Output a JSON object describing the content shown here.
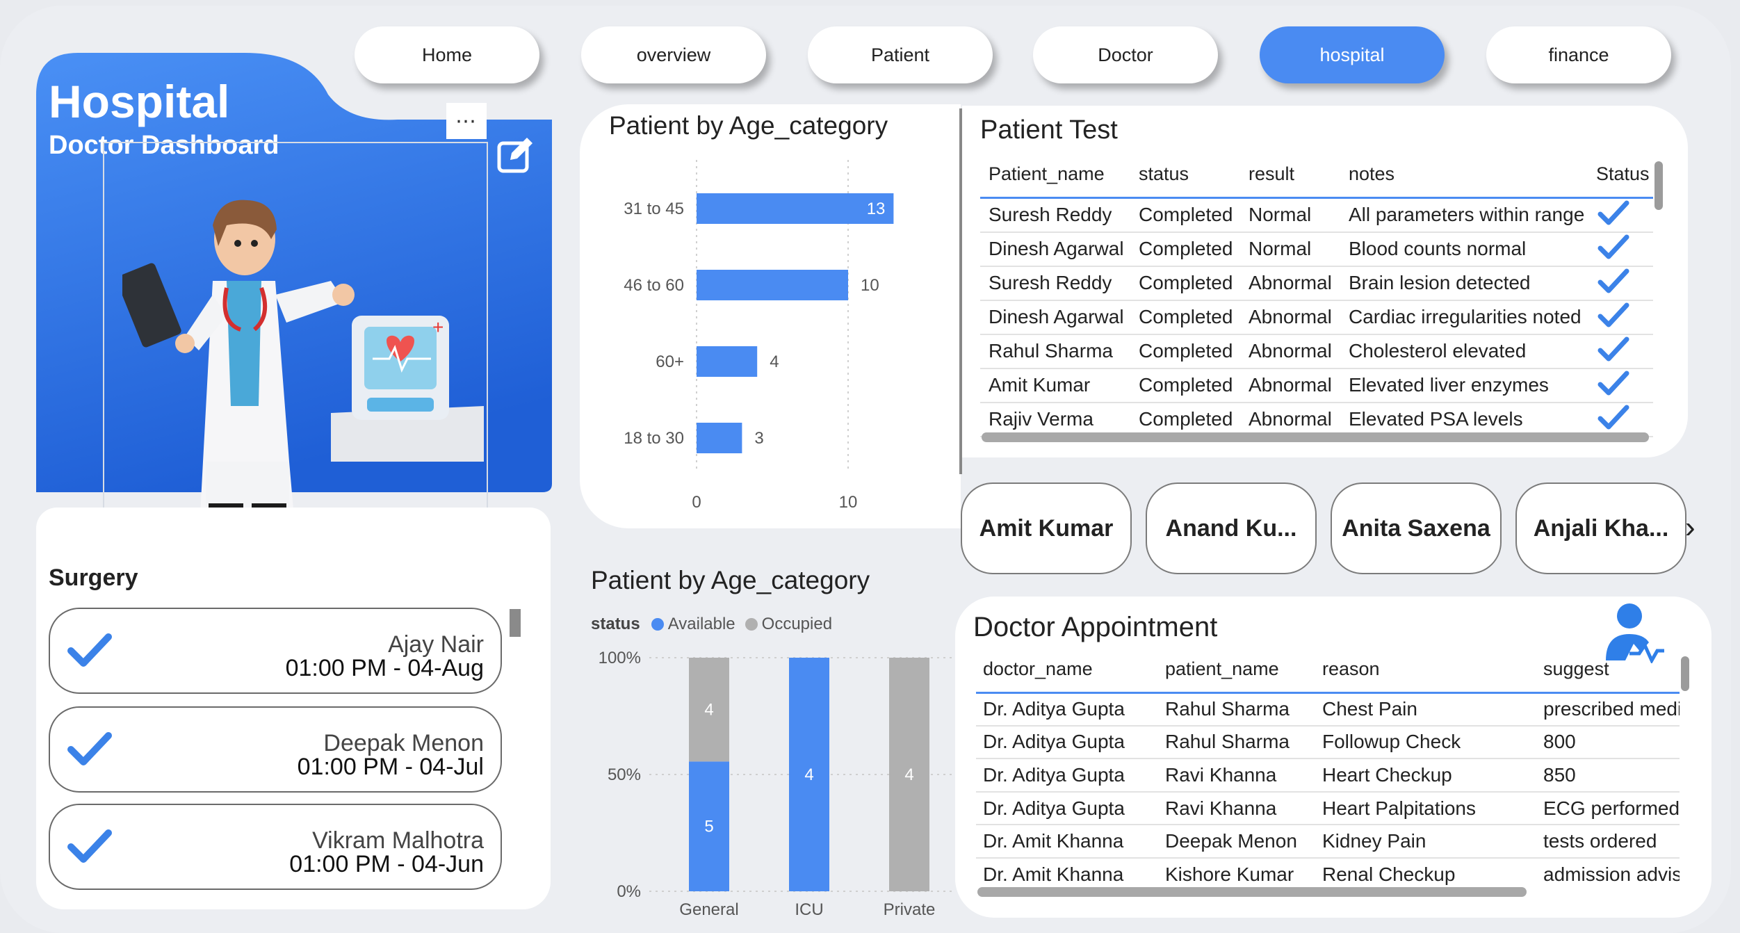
{
  "nav": {
    "items": [
      {
        "label": "Home",
        "active": false
      },
      {
        "label": "overview",
        "active": false
      },
      {
        "label": "Patient",
        "active": false
      },
      {
        "label": "Doctor",
        "active": false
      },
      {
        "label": "hospital",
        "active": true
      },
      {
        "label": "finance",
        "active": false
      }
    ]
  },
  "hero": {
    "title": "Hospital",
    "subtitle": "Doctor Dashboard",
    "menu_icon": "more-horizontal-icon",
    "edit_icon": "edit-icon",
    "illustration": "doctor-illustration"
  },
  "surgery": {
    "title": "Surgery",
    "items": [
      {
        "name": "Ajay Nair",
        "time": "01:00 PM - 04-Aug"
      },
      {
        "name": "Deepak Menon",
        "time": "01:00 PM - 04-Jul"
      },
      {
        "name": "Vikram Malhotra",
        "time": "01:00 PM - 04-Jun"
      }
    ]
  },
  "chart_data": [
    {
      "type": "bar",
      "title": "Patient by Age_category",
      "orientation": "horizontal",
      "categories": [
        "31 to 45",
        "46 to 60",
        "60+",
        "18 to 30"
      ],
      "values": [
        13,
        10,
        4,
        3
      ],
      "xlim": [
        0,
        13
      ],
      "xticks": [
        0,
        10
      ],
      "color": "#4a8bf2"
    },
    {
      "type": "bar",
      "stacked": "percent",
      "title": "Patient by Age_category",
      "legend_title": "status",
      "categories": [
        "General",
        "ICU",
        "Private"
      ],
      "yticks": [
        "0%",
        "50%",
        "100%"
      ],
      "series": [
        {
          "name": "Available",
          "color": "#4a8bf2",
          "values": [
            5,
            4,
            0
          ]
        },
        {
          "name": "Occupied",
          "color": "#b0b0b0",
          "values": [
            4,
            0,
            4
          ]
        }
      ]
    }
  ],
  "patient_test": {
    "title": "Patient Test",
    "columns": [
      "Patient_name",
      "status",
      "result",
      "notes",
      "Status"
    ],
    "rows": [
      [
        "Suresh Reddy",
        "Completed",
        "Normal",
        "All parameters within range"
      ],
      [
        "Dinesh Agarwal",
        "Completed",
        "Normal",
        "Blood counts normal"
      ],
      [
        "Suresh Reddy",
        "Completed",
        "Abnormal",
        "Brain lesion detected"
      ],
      [
        "Dinesh Agarwal",
        "Completed",
        "Abnormal",
        "Cardiac irregularities noted"
      ],
      [
        "Rahul Sharma",
        "Completed",
        "Abnormal",
        "Cholesterol elevated"
      ],
      [
        "Amit Kumar",
        "Completed",
        "Abnormal",
        "Elevated liver enzymes"
      ],
      [
        "Rajiv Verma",
        "Completed",
        "Abnormal",
        "Elevated PSA levels"
      ]
    ]
  },
  "doctors": {
    "cards": [
      "Amit Kumar",
      "Anand Ku...",
      "Anita Saxena",
      "Anjali Kha..."
    ],
    "next_icon": "chevron-right-icon"
  },
  "appointment": {
    "title": "Doctor Appointment",
    "icon": "doctor-heartbeat-icon",
    "columns": [
      "doctor_name",
      "patient_name",
      "reason",
      "suggest"
    ],
    "rows": [
      [
        "Dr. Aditya Gupta",
        "Rahul Sharma",
        "Chest Pain",
        "prescribed medi"
      ],
      [
        "Dr. Aditya Gupta",
        "Rahul Sharma",
        "Followup Check",
        "800"
      ],
      [
        "Dr. Aditya Gupta",
        "Ravi Khanna",
        "Heart Checkup",
        "850"
      ],
      [
        "Dr. Aditya Gupta",
        "Ravi Khanna",
        "Heart Palpitations",
        "ECG performed"
      ],
      [
        "Dr. Amit Khanna",
        "Deepak Menon",
        "Kidney Pain",
        "tests ordered"
      ],
      [
        "Dr. Amit Khanna",
        "Kishore Kumar",
        "Renal Checkup",
        "admission advise"
      ]
    ]
  }
}
